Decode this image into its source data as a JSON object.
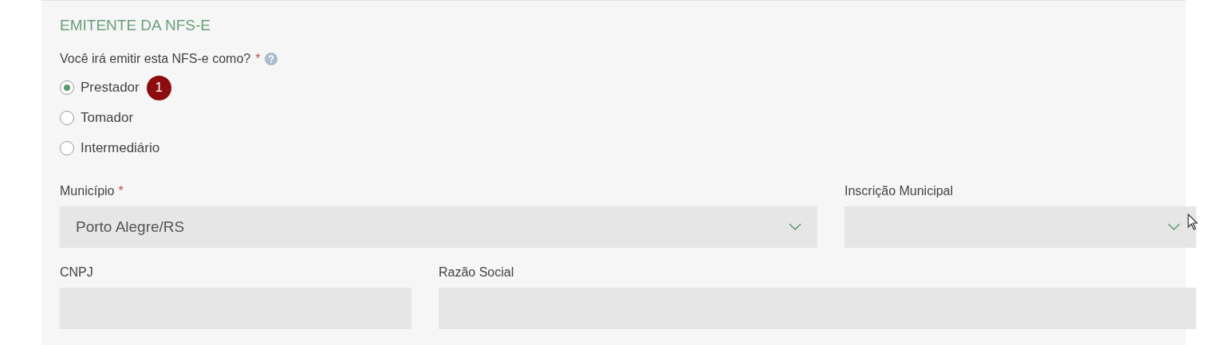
{
  "section": {
    "title": "EMITENTE DA NFS-E"
  },
  "question": {
    "label": "Você irá emitir esta NFS-e como?",
    "required_mark": "*"
  },
  "options": [
    {
      "label": "Prestador",
      "selected": true,
      "badge": "1"
    },
    {
      "label": "Tomador",
      "selected": false
    },
    {
      "label": "Intermediário",
      "selected": false
    }
  ],
  "fields": [
    {
      "label": "Município",
      "required_mark": "*",
      "kind": "select",
      "value": "Porto Alegre/RS"
    },
    {
      "label": "Inscrição Municipal",
      "kind": "select"
    },
    {
      "label": "CNPJ",
      "kind": "text"
    },
    {
      "label": "Razão Social",
      "kind": "text"
    }
  ]
}
